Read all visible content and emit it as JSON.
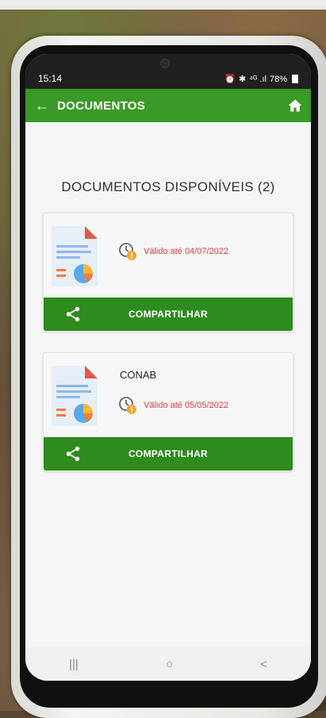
{
  "status_bar": {
    "time": "15:14",
    "icons": [
      "alarm-icon",
      "bluetooth-icon",
      "signal-icon"
    ],
    "signal_text": "⁴ᴳ .ıl",
    "battery": "78%"
  },
  "app_bar": {
    "title": "DOCUMENTOS",
    "back_icon": "arrow-left-icon",
    "home_icon": "home-icon",
    "color": "#3a9a27"
  },
  "section": {
    "title": "DOCUMENTOS DISPONÍVEIS (2)"
  },
  "documents": [
    {
      "name": "",
      "validity": "Válido até 04/07/2022",
      "share_label": "COMPARTILHAR"
    },
    {
      "name": "CONAB",
      "validity": "Válido até 05/05/2022",
      "share_label": "COMPARTILHAR"
    }
  ],
  "nav_bar": {
    "recents": "|||",
    "home": "○",
    "back": "<"
  },
  "colors": {
    "accent": "#3a9a27",
    "share_bar": "#2e8b1d",
    "validity_text": "#e23b3b"
  }
}
